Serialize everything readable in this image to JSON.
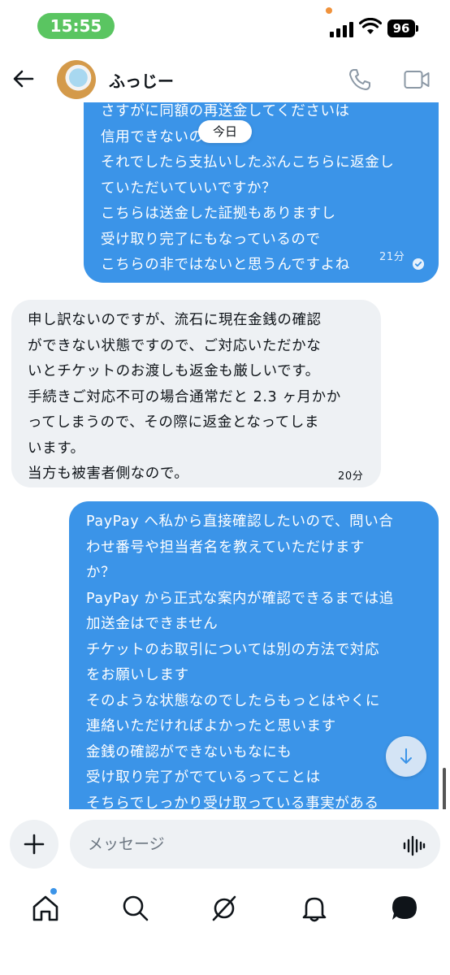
{
  "status_bar": {
    "time": "15:55",
    "battery": "96"
  },
  "header": {
    "contact_name": "ふっじー",
    "back_icon": "arrow-left-icon",
    "call_icon": "phone-icon",
    "video_icon": "video-camera-icon"
  },
  "chat": {
    "date_divider": "今日",
    "messages": [
      {
        "direction": "outgoing",
        "lines": [
          "さすがに同額の再送金してくださいは",
          "信用できないので",
          "それでしたら支払いしたぶんこちらに返金し",
          "ていただいていいですか？",
          "こちらは送金した証拠もありますし",
          "受け取り完了にもなっているので",
          "こちらの非ではないと思うんですよね"
        ],
        "time": "21分",
        "status_icon": "read-check-icon"
      },
      {
        "direction": "incoming",
        "lines": [
          "申し訳ないのですが、流石に現在金銭の確認",
          "ができない状態ですので、ご対応いただかな",
          "いとチケットのお渡しも返金も厳しいです。",
          "手続きご対応不可の場合通常だと 2.3 ヶ月かか",
          "ってしまうので、その際に返金となってしま",
          "います。",
          "当方も被害者側なので。"
        ],
        "time": "20分"
      },
      {
        "direction": "outgoing",
        "lines": [
          "PayPay へ私から直接確認したいので、問い合",
          "わせ番号や担当者名を教えていただけます",
          "か？",
          "PayPay から正式な案内が確認できるまでは追",
          "加送金はできません",
          "チケットのお取引については別の方法で対応",
          "をお願いします",
          "そのような状態なのでしたらもっとはやくに",
          "連絡いただければよかったと思います",
          "金銭の確認ができないもなにも",
          "受け取り完了がでているってことは",
          "そちらでしっかり受け取っている事実がある"
        ]
      }
    ]
  },
  "composer": {
    "placeholder": "メッセージ",
    "plus_icon": "plus-icon",
    "voice_icon": "voice-wave-icon"
  },
  "tabs": [
    {
      "name": "home",
      "icon": "home-icon",
      "has_badge": true
    },
    {
      "name": "search",
      "icon": "search-icon"
    },
    {
      "name": "grok",
      "icon": "grok-icon"
    },
    {
      "name": "notifications",
      "icon": "bell-icon"
    },
    {
      "name": "messages",
      "icon": "message-bubble-icon",
      "active": true
    }
  ],
  "colors": {
    "outgoing_bubble": "#3b94e8",
    "incoming_bubble": "#eef1f4",
    "time_pill": "#5ac561"
  }
}
